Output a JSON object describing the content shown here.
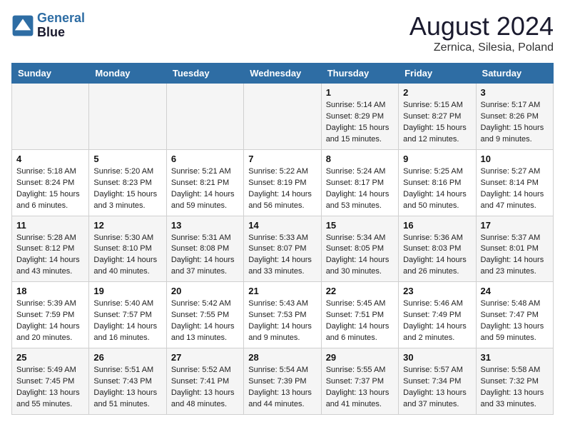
{
  "header": {
    "logo_line1": "General",
    "logo_line2": "Blue",
    "month_year": "August 2024",
    "location": "Zernica, Silesia, Poland"
  },
  "weekdays": [
    "Sunday",
    "Monday",
    "Tuesday",
    "Wednesday",
    "Thursday",
    "Friday",
    "Saturday"
  ],
  "weeks": [
    [
      {
        "day": "",
        "info": ""
      },
      {
        "day": "",
        "info": ""
      },
      {
        "day": "",
        "info": ""
      },
      {
        "day": "",
        "info": ""
      },
      {
        "day": "1",
        "info": "Sunrise: 5:14 AM\nSunset: 8:29 PM\nDaylight: 15 hours\nand 15 minutes."
      },
      {
        "day": "2",
        "info": "Sunrise: 5:15 AM\nSunset: 8:27 PM\nDaylight: 15 hours\nand 12 minutes."
      },
      {
        "day": "3",
        "info": "Sunrise: 5:17 AM\nSunset: 8:26 PM\nDaylight: 15 hours\nand 9 minutes."
      }
    ],
    [
      {
        "day": "4",
        "info": "Sunrise: 5:18 AM\nSunset: 8:24 PM\nDaylight: 15 hours\nand 6 minutes."
      },
      {
        "day": "5",
        "info": "Sunrise: 5:20 AM\nSunset: 8:23 PM\nDaylight: 15 hours\nand 3 minutes."
      },
      {
        "day": "6",
        "info": "Sunrise: 5:21 AM\nSunset: 8:21 PM\nDaylight: 14 hours\nand 59 minutes."
      },
      {
        "day": "7",
        "info": "Sunrise: 5:22 AM\nSunset: 8:19 PM\nDaylight: 14 hours\nand 56 minutes."
      },
      {
        "day": "8",
        "info": "Sunrise: 5:24 AM\nSunset: 8:17 PM\nDaylight: 14 hours\nand 53 minutes."
      },
      {
        "day": "9",
        "info": "Sunrise: 5:25 AM\nSunset: 8:16 PM\nDaylight: 14 hours\nand 50 minutes."
      },
      {
        "day": "10",
        "info": "Sunrise: 5:27 AM\nSunset: 8:14 PM\nDaylight: 14 hours\nand 47 minutes."
      }
    ],
    [
      {
        "day": "11",
        "info": "Sunrise: 5:28 AM\nSunset: 8:12 PM\nDaylight: 14 hours\nand 43 minutes."
      },
      {
        "day": "12",
        "info": "Sunrise: 5:30 AM\nSunset: 8:10 PM\nDaylight: 14 hours\nand 40 minutes."
      },
      {
        "day": "13",
        "info": "Sunrise: 5:31 AM\nSunset: 8:08 PM\nDaylight: 14 hours\nand 37 minutes."
      },
      {
        "day": "14",
        "info": "Sunrise: 5:33 AM\nSunset: 8:07 PM\nDaylight: 14 hours\nand 33 minutes."
      },
      {
        "day": "15",
        "info": "Sunrise: 5:34 AM\nSunset: 8:05 PM\nDaylight: 14 hours\nand 30 minutes."
      },
      {
        "day": "16",
        "info": "Sunrise: 5:36 AM\nSunset: 8:03 PM\nDaylight: 14 hours\nand 26 minutes."
      },
      {
        "day": "17",
        "info": "Sunrise: 5:37 AM\nSunset: 8:01 PM\nDaylight: 14 hours\nand 23 minutes."
      }
    ],
    [
      {
        "day": "18",
        "info": "Sunrise: 5:39 AM\nSunset: 7:59 PM\nDaylight: 14 hours\nand 20 minutes."
      },
      {
        "day": "19",
        "info": "Sunrise: 5:40 AM\nSunset: 7:57 PM\nDaylight: 14 hours\nand 16 minutes."
      },
      {
        "day": "20",
        "info": "Sunrise: 5:42 AM\nSunset: 7:55 PM\nDaylight: 14 hours\nand 13 minutes."
      },
      {
        "day": "21",
        "info": "Sunrise: 5:43 AM\nSunset: 7:53 PM\nDaylight: 14 hours\nand 9 minutes."
      },
      {
        "day": "22",
        "info": "Sunrise: 5:45 AM\nSunset: 7:51 PM\nDaylight: 14 hours\nand 6 minutes."
      },
      {
        "day": "23",
        "info": "Sunrise: 5:46 AM\nSunset: 7:49 PM\nDaylight: 14 hours\nand 2 minutes."
      },
      {
        "day": "24",
        "info": "Sunrise: 5:48 AM\nSunset: 7:47 PM\nDaylight: 13 hours\nand 59 minutes."
      }
    ],
    [
      {
        "day": "25",
        "info": "Sunrise: 5:49 AM\nSunset: 7:45 PM\nDaylight: 13 hours\nand 55 minutes."
      },
      {
        "day": "26",
        "info": "Sunrise: 5:51 AM\nSunset: 7:43 PM\nDaylight: 13 hours\nand 51 minutes."
      },
      {
        "day": "27",
        "info": "Sunrise: 5:52 AM\nSunset: 7:41 PM\nDaylight: 13 hours\nand 48 minutes."
      },
      {
        "day": "28",
        "info": "Sunrise: 5:54 AM\nSunset: 7:39 PM\nDaylight: 13 hours\nand 44 minutes."
      },
      {
        "day": "29",
        "info": "Sunrise: 5:55 AM\nSunset: 7:37 PM\nDaylight: 13 hours\nand 41 minutes."
      },
      {
        "day": "30",
        "info": "Sunrise: 5:57 AM\nSunset: 7:34 PM\nDaylight: 13 hours\nand 37 minutes."
      },
      {
        "day": "31",
        "info": "Sunrise: 5:58 AM\nSunset: 7:32 PM\nDaylight: 13 hours\nand 33 minutes."
      }
    ]
  ]
}
